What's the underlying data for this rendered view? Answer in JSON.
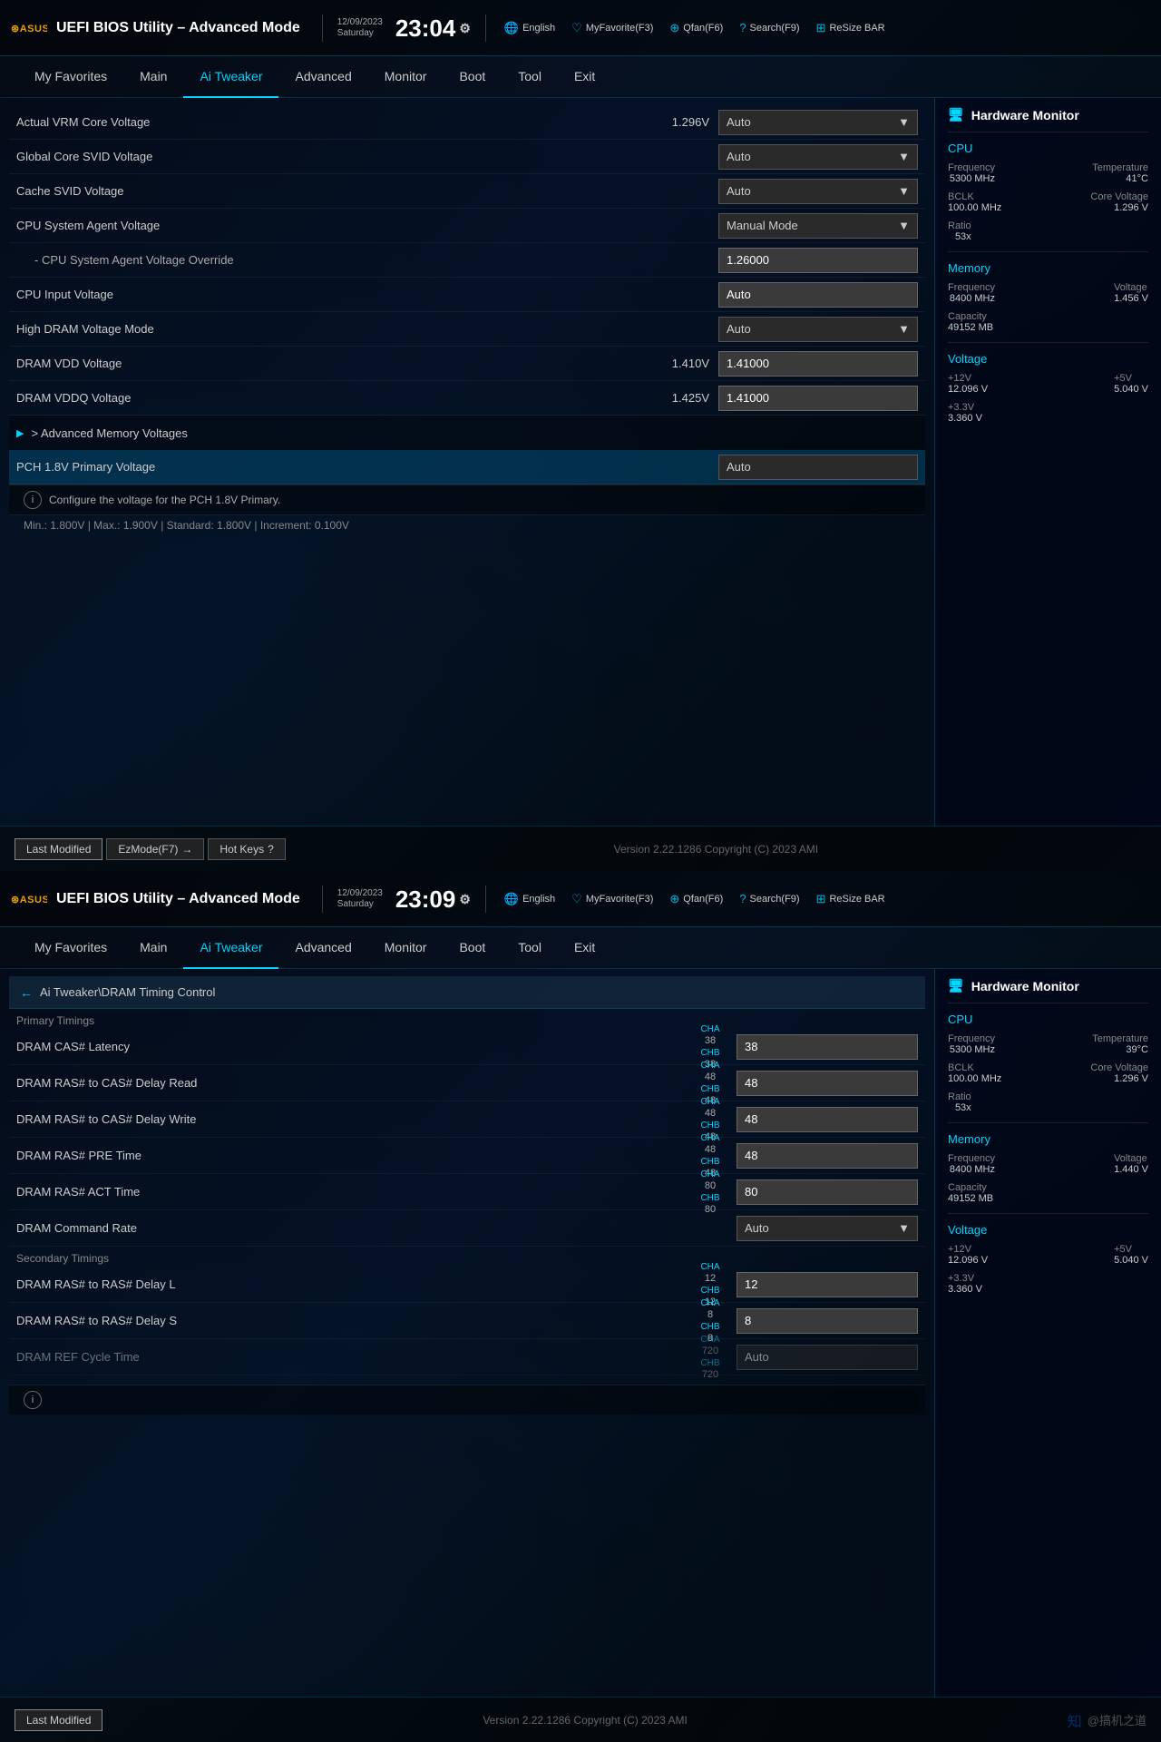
{
  "screen1": {
    "header": {
      "logo": "ASUS",
      "title": "UEFI BIOS Utility – Advanced Mode",
      "date": "12/09/2023\nSaturday",
      "time": "23:04",
      "topbar_items": [
        {
          "label": "English",
          "key": ""
        },
        {
          "label": "MyFavorite(F3)",
          "key": "F3"
        },
        {
          "label": "Qfan(F6)",
          "key": "F6"
        },
        {
          "label": "Search(F9)",
          "key": "F9"
        },
        {
          "label": "ReSize BAR",
          "key": ""
        }
      ]
    },
    "nav": {
      "items": [
        "My Favorites",
        "Main",
        "Ai Tweaker",
        "Advanced",
        "Monitor",
        "Boot",
        "Tool",
        "Exit"
      ],
      "active": "Ai Tweaker"
    },
    "settings": [
      {
        "label": "Actual VRM Core Voltage",
        "value": "1.296V",
        "control": "dropdown",
        "current": "Auto"
      },
      {
        "label": "Global Core SVID Voltage",
        "value": "",
        "control": "dropdown",
        "current": "Auto"
      },
      {
        "label": "Cache SVID Voltage",
        "value": "",
        "control": "dropdown",
        "current": "Auto"
      },
      {
        "label": "CPU System Agent Voltage",
        "value": "",
        "control": "dropdown",
        "current": "Manual Mode"
      },
      {
        "label": "- CPU System Agent Voltage Override",
        "value": "",
        "control": "input",
        "current": "1.26000",
        "sub": true
      },
      {
        "label": "CPU Input Voltage",
        "value": "",
        "control": "input",
        "current": "Auto"
      },
      {
        "label": "High DRAM Voltage Mode",
        "value": "",
        "control": "dropdown",
        "current": "Auto"
      },
      {
        "label": "DRAM VDD Voltage",
        "value": "1.410V",
        "control": "input",
        "current": "1.41000"
      },
      {
        "label": "DRAM VDDQ Voltage",
        "value": "1.425V",
        "control": "input",
        "current": "1.41000"
      },
      {
        "label": "> Advanced Memory Voltages",
        "value": "",
        "control": "section",
        "current": ""
      },
      {
        "label": "PCH 1.8V Primary Voltage",
        "value": "",
        "control": "dropdown",
        "current": "Auto",
        "highlighted": true
      }
    ],
    "info_text": "Configure the voltage for the PCH 1.8V Primary.",
    "spec_text": "Min.: 1.800V  |  Max.: 1.900V  |  Standard: 1.800V  |  Increment: 0.100V",
    "hw_monitor": {
      "title": "Hardware Monitor",
      "cpu": {
        "title": "CPU",
        "frequency_label": "Frequency",
        "frequency_val": "5300 MHz",
        "temperature_label": "Temperature",
        "temperature_val": "41°C",
        "bclk_label": "BCLK",
        "bclk_val": "100.00 MHz",
        "core_voltage_label": "Core Voltage",
        "core_voltage_val": "1.296 V",
        "ratio_label": "Ratio",
        "ratio_val": "53x"
      },
      "memory": {
        "title": "Memory",
        "frequency_label": "Frequency",
        "frequency_val": "8400 MHz",
        "voltage_label": "Voltage",
        "voltage_val": "1.456 V",
        "capacity_label": "Capacity",
        "capacity_val": "49152 MB"
      },
      "voltage": {
        "title": "Voltage",
        "v12_label": "+12V",
        "v12_val": "12.096 V",
        "v5_label": "+5V",
        "v5_val": "5.040 V",
        "v33_label": "+3.3V",
        "v33_val": "3.360 V"
      }
    },
    "bottom": {
      "last_modified": "Last Modified",
      "ez_mode": "EzMode(F7)",
      "hot_keys": "Hot Keys",
      "version": "Version 2.22.1286 Copyright (C) 2023 AMI"
    }
  },
  "screen2": {
    "header": {
      "logo": "ASUS",
      "title": "UEFI BIOS Utility – Advanced Mode",
      "date": "12/09/2023\nSaturday",
      "time": "23:09",
      "topbar_items": [
        {
          "label": "English",
          "key": ""
        },
        {
          "label": "MyFavorite(F3)",
          "key": "F3"
        },
        {
          "label": "Qfan(F6)",
          "key": "F6"
        },
        {
          "label": "Search(F9)",
          "key": "F9"
        },
        {
          "label": "ReSize BAR",
          "key": ""
        }
      ]
    },
    "nav": {
      "items": [
        "My Favorites",
        "Main",
        "Ai Tweaker",
        "Advanced",
        "Monitor",
        "Boot",
        "Tool",
        "Exit"
      ],
      "active": "Ai Tweaker"
    },
    "breadcrumb": "Ai Tweaker\\DRAM Timing Control",
    "primary_timings_label": "Primary Timings",
    "secondary_timings_label": "Secondary Timings",
    "timings": [
      {
        "label": "DRAM CAS# Latency",
        "cha": "38",
        "chb": "38",
        "val": "38",
        "section": "primary"
      },
      {
        "label": "DRAM RAS# to CAS# Delay Read",
        "cha": "48",
        "chb": "48",
        "val": "48",
        "section": "primary"
      },
      {
        "label": "DRAM RAS# to CAS# Delay Write",
        "cha": "48",
        "chb": "48",
        "val": "48",
        "section": "primary"
      },
      {
        "label": "DRAM RAS# PRE Time",
        "cha": "48",
        "chb": "48",
        "val": "48",
        "section": "primary"
      },
      {
        "label": "DRAM RAS# ACT Time",
        "cha": "80",
        "chb": "80",
        "val": "80",
        "section": "primary"
      },
      {
        "label": "DRAM Command Rate",
        "cha": "",
        "chb": "",
        "val": "Auto",
        "control": "dropdown",
        "section": "primary"
      },
      {
        "label": "DRAM RAS# to RAS# Delay L",
        "cha": "12",
        "chb": "12",
        "val": "12",
        "section": "secondary"
      },
      {
        "label": "DRAM RAS# to RAS# Delay S",
        "cha": "8",
        "chb": "8",
        "val": "8",
        "section": "secondary"
      },
      {
        "label": "DRAM REF Cycle Time",
        "cha": "720",
        "chb": "720",
        "val": "Auto",
        "disabled": true,
        "section": "secondary"
      }
    ],
    "hw_monitor": {
      "title": "Hardware Monitor",
      "cpu": {
        "title": "CPU",
        "frequency_label": "Frequency",
        "frequency_val": "5300 MHz",
        "temperature_label": "Temperature",
        "temperature_val": "39°C",
        "bclk_label": "BCLK",
        "bclk_val": "100.00 MHz",
        "core_voltage_label": "Core Voltage",
        "core_voltage_val": "1.296 V",
        "ratio_label": "Ratio",
        "ratio_val": "53x"
      },
      "memory": {
        "title": "Memory",
        "frequency_label": "Frequency",
        "frequency_val": "8400 MHz",
        "voltage_label": "Voltage",
        "voltage_val": "1.440 V",
        "capacity_label": "Capacity",
        "capacity_val": "49152 MB"
      },
      "voltage": {
        "title": "Voltage",
        "v12_label": "+12V",
        "v12_val": "12.096 V",
        "v5_label": "+5V",
        "v5_val": "5.040 V",
        "v33_label": "+3.3V",
        "v33_val": "3.360 V"
      }
    },
    "bottom": {
      "last_modified": "Last Modified",
      "version": "Version 2.22.1286 Copyright (C) 2023 AMI"
    }
  }
}
